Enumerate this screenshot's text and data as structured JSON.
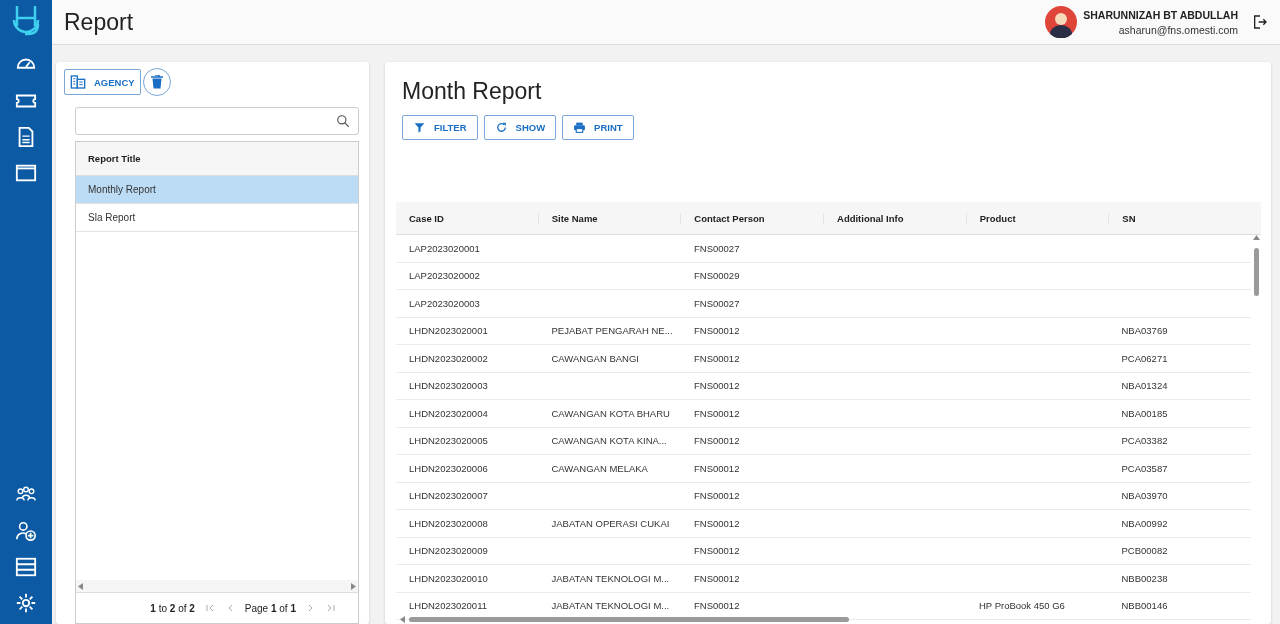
{
  "header": {
    "title": "Report",
    "user": {
      "name": "SHARUNNIZAH BT ABDULLAH",
      "email": "asharun@fns.omesti.com"
    }
  },
  "report_panel": {
    "agency_button": "AGENCY",
    "list": {
      "column": "Report Title",
      "rows": [
        {
          "title": "Monthly Report",
          "selected": true
        },
        {
          "title": "Sla Report",
          "selected": false
        }
      ]
    },
    "pagination": {
      "summary": "**1** to **2** of **2**",
      "page": "Page **1** of **1**"
    }
  },
  "report_view": {
    "title": "Month Report",
    "actions": [
      {
        "label": "FILTER",
        "kind": "filter"
      },
      {
        "label": "SHOW",
        "kind": "refresh"
      },
      {
        "label": "PRINT",
        "kind": "print"
      }
    ],
    "table": {
      "columns": [
        "Case ID",
        "Site Name",
        "Contact Person",
        "Additional Info",
        "Product",
        "SN"
      ],
      "rows": [
        [
          "LAP2023020001",
          "",
          "FNS00027",
          "",
          "",
          ""
        ],
        [
          "LAP2023020002",
          "",
          "FNS00029",
          "",
          "",
          ""
        ],
        [
          "LAP2023020003",
          "",
          "FNS00027",
          "",
          "",
          ""
        ],
        [
          "LHDN2023020001",
          "PEJABAT PENGARAH NE...",
          "FNS00012",
          "",
          "",
          "NBA03769"
        ],
        [
          "LHDN2023020002",
          "CAWANGAN BANGI",
          "FNS00012",
          "",
          "",
          "PCA06271"
        ],
        [
          "LHDN2023020003",
          "",
          "FNS00012",
          "",
          "",
          "NBA01324"
        ],
        [
          "LHDN2023020004",
          "CAWANGAN KOTA BHARU",
          "FNS00012",
          "",
          "",
          "NBA00185"
        ],
        [
          "LHDN2023020005",
          "CAWANGAN KOTA KINA...",
          "FNS00012",
          "",
          "",
          "PCA03382"
        ],
        [
          "LHDN2023020006",
          "CAWANGAN MELAKA",
          "FNS00012",
          "",
          "",
          "PCA03587"
        ],
        [
          "LHDN2023020007",
          "",
          "FNS00012",
          "",
          "",
          "NBA03970"
        ],
        [
          "LHDN2023020008",
          "JABATAN OPERASI CUKAI",
          "FNS00012",
          "",
          "",
          "NBA00992"
        ],
        [
          "LHDN2023020009",
          "",
          "FNS00012",
          "",
          "",
          "PCB00082"
        ],
        [
          "LHDN2023020010",
          "JABATAN TEKNOLOGI M...",
          "FNS00012",
          "",
          "",
          "NBB00238"
        ],
        [
          "LHDN2023020011",
          "JABATAN TEKNOLOGI M...",
          "FNS00012",
          "",
          "HP ProBook 450 G6",
          "NBB00146"
        ]
      ]
    }
  }
}
